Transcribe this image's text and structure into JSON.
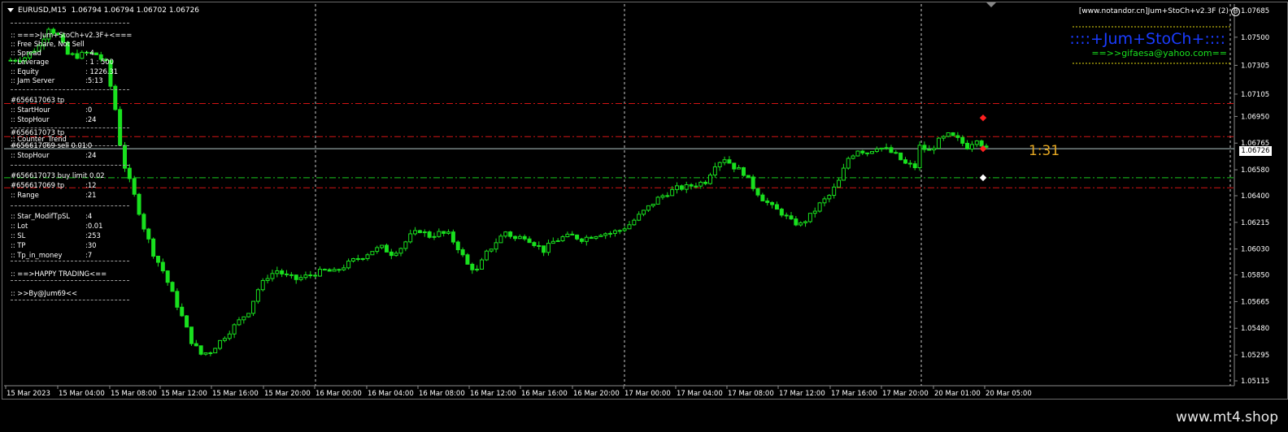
{
  "header": {
    "symbol": "EURUSD,M15",
    "ohlc": "1.06794 1.06794 1.06702 1.06726"
  },
  "ea": {
    "title": "[www.notandor.cn]Jum+StoCh+v2.3F (2)",
    "brand": "::::+Jum+StoCh+::::",
    "email": "==>>gifaesa@yahoo.com=="
  },
  "panel": {
    "rows": [
      {
        "label": ":: ===>Jum+StoCh+v2.3F+<===",
        "value": ""
      },
      {
        "label": ":: Free Share, Not Sell",
        "value": ""
      },
      {
        "label": ":: Spread",
        "value": ": 4"
      },
      {
        "label": ":: Leverage",
        "value": ": 1 : 500"
      },
      {
        "label": ":: Equity",
        "value": ": 1226.31"
      },
      {
        "label": ":: Jam Server",
        "value": ":5:13"
      },
      {
        "label": "#656617063 tp",
        "value": ""
      },
      {
        "label": ":: StartHour",
        "value": ":0"
      },
      {
        "label": ":: StopHour",
        "value": ":24"
      },
      {
        "label": "#656617073 tp",
        "value": ""
      },
      {
        "label": ":: Counter_Trend",
        "value": ""
      },
      {
        "label": "#656617069 sell 0.01",
        "value": ":0"
      },
      {
        "label": ":: StopHour",
        "value": ":24"
      },
      {
        "label": "#656617073 buy limit 0.02",
        "value": ""
      },
      {
        "label": "#656617069 tp",
        "value": ":12"
      },
      {
        "label": ":: Range",
        "value": ":21"
      },
      {
        "label": ":: Star_ModifTpSL",
        "value": ":4"
      },
      {
        "label": ":: Lot",
        "value": ":0.01"
      },
      {
        "label": ":: SL",
        "value": ":253"
      },
      {
        "label": ":: TP",
        "value": ":30"
      },
      {
        "label": ":: Tp_in_money",
        "value": ":7"
      },
      {
        "label": ":: ==>HAPPY TRADING<==",
        "value": ""
      },
      {
        "label": ":: >>By@Jum69<<",
        "value": ""
      }
    ]
  },
  "ratio_label": "1:31",
  "current_price": "1.06726",
  "watermark": "www.mt4.shop",
  "colors": {
    "background": "#000000",
    "candle": "#19e01e",
    "tp_line": "#d21414",
    "pending_line": "#19c81e",
    "bid_line": "#b4c8c8",
    "period_sep": "#c8c8c8",
    "brand": "#1a3cff",
    "ratio": "#e6a822"
  },
  "chart_data": {
    "type": "candlestick",
    "y_ticks": [
      "1.07685",
      "1.07500",
      "1.07305",
      "1.07105",
      "1.06950",
      "1.06765",
      "1.06580",
      "1.06400",
      "1.06215",
      "1.06030",
      "1.05850",
      "1.05665",
      "1.05480",
      "1.05295",
      "1.05115"
    ],
    "x_ticks": [
      "15 Mar 2023",
      "15 Mar 04:00",
      "15 Mar 08:00",
      "15 Mar 12:00",
      "15 Mar 16:00",
      "15 Mar 20:00",
      "16 Mar 00:00",
      "16 Mar 04:00",
      "16 Mar 08:00",
      "16 Mar 12:00",
      "16 Mar 16:00",
      "16 Mar 20:00",
      "17 Mar 00:00",
      "17 Mar 04:00",
      "17 Mar 08:00",
      "17 Mar 12:00",
      "17 Mar 16:00",
      "17 Mar 20:00",
      "20 Mar 01:00",
      "20 Mar 05:00"
    ],
    "price_path": [
      [
        0,
        1.0734
      ],
      [
        3,
        1.0736
      ],
      [
        6,
        1.0744
      ],
      [
        8,
        1.0757
      ],
      [
        10,
        1.0751
      ],
      [
        12,
        1.0738
      ],
      [
        14,
        1.0737
      ],
      [
        16,
        1.0739
      ],
      [
        18,
        1.0738
      ],
      [
        20,
        1.0732
      ],
      [
        22,
        1.07
      ],
      [
        23,
        1.0676
      ],
      [
        24,
        1.066
      ],
      [
        26,
        1.064
      ],
      [
        28,
        1.0618
      ],
      [
        30,
        1.06
      ],
      [
        32,
        1.0588
      ],
      [
        34,
        1.0572
      ],
      [
        36,
        1.0556
      ],
      [
        38,
        1.0539
      ],
      [
        40,
        1.053
      ],
      [
        42,
        1.0532
      ],
      [
        44,
        1.0539
      ],
      [
        46,
        1.0546
      ],
      [
        48,
        1.0553
      ],
      [
        50,
        1.056
      ],
      [
        52,
        1.0575
      ],
      [
        54,
        1.0584
      ],
      [
        56,
        1.0588
      ],
      [
        58,
        1.0584
      ],
      [
        60,
        1.0582
      ],
      [
        62,
        1.0584
      ],
      [
        64,
        1.0586
      ],
      [
        66,
        1.0588
      ],
      [
        68,
        1.0587
      ],
      [
        70,
        1.0591
      ],
      [
        72,
        1.0595
      ],
      [
        74,
        1.0598
      ],
      [
        76,
        1.0602
      ],
      [
        78,
        1.0604
      ],
      [
        80,
        1.06
      ],
      [
        82,
        1.0604
      ],
      [
        84,
        1.0612
      ],
      [
        86,
        1.0616
      ],
      [
        88,
        1.0612
      ],
      [
        90,
        1.0614
      ],
      [
        92,
        1.0613
      ],
      [
        94,
        1.0604
      ],
      [
        96,
        1.0592
      ],
      [
        98,
        1.0588
      ],
      [
        100,
        1.06
      ],
      [
        102,
        1.0608
      ],
      [
        104,
        1.0615
      ],
      [
        106,
        1.061
      ],
      [
        108,
        1.0612
      ],
      [
        110,
        1.0607
      ],
      [
        112,
        1.0602
      ],
      [
        114,
        1.0608
      ],
      [
        116,
        1.0611
      ],
      [
        118,
        1.0612
      ],
      [
        120,
        1.061
      ],
      [
        122,
        1.0612
      ],
      [
        124,
        1.0614
      ],
      [
        126,
        1.0614
      ],
      [
        128,
        1.0616
      ],
      [
        130,
        1.062
      ],
      [
        132,
        1.0626
      ],
      [
        134,
        1.0632
      ],
      [
        136,
        1.0638
      ],
      [
        138,
        1.0642
      ],
      [
        140,
        1.0645
      ],
      [
        142,
        1.0646
      ],
      [
        144,
        1.0648
      ],
      [
        146,
        1.065
      ],
      [
        148,
        1.0662
      ],
      [
        150,
        1.0666
      ],
      [
        152,
        1.066
      ],
      [
        154,
        1.0656
      ],
      [
        156,
        1.0646
      ],
      [
        158,
        1.0638
      ],
      [
        160,
        1.0632
      ],
      [
        162,
        1.0628
      ],
      [
        164,
        1.0622
      ],
      [
        166,
        1.062
      ],
      [
        168,
        1.0626
      ],
      [
        170,
        1.0634
      ],
      [
        172,
        1.064
      ],
      [
        174,
        1.065
      ],
      [
        176,
        1.0666
      ],
      [
        178,
        1.0672
      ],
      [
        180,
        1.067
      ],
      [
        182,
        1.0674
      ],
      [
        184,
        1.0672
      ],
      [
        186,
        1.0668
      ],
      [
        188,
        1.0662
      ],
      [
        190,
        1.066
      ],
      [
        191,
        1.0674
      ],
      [
        193,
        1.0671
      ],
      [
        195,
        1.0678
      ],
      [
        197,
        1.0682
      ],
      [
        199,
        1.0679
      ],
      [
        201,
        1.0674
      ],
      [
        203,
        1.068
      ],
      [
        205,
        1.0672
      ]
    ],
    "levels": [
      {
        "kind": "tp",
        "price": 1.0704
      },
      {
        "kind": "tp",
        "price": 1.0681
      },
      {
        "kind": "bid",
        "price": 1.06726
      },
      {
        "kind": "pending",
        "price": 1.06525
      },
      {
        "kind": "tp",
        "price": 1.06455
      }
    ]
  }
}
